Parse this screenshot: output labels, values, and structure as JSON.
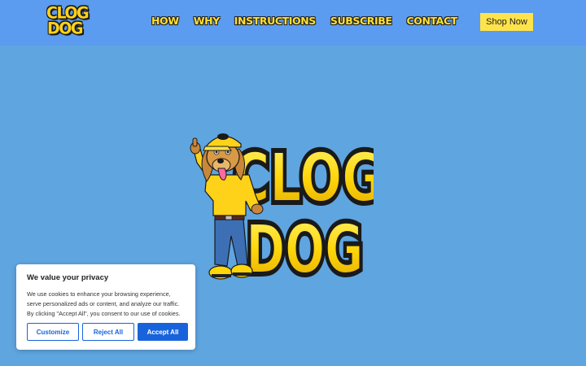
{
  "logo": {
    "line1": "CLOG",
    "line2": "DOG"
  },
  "nav": {
    "items": [
      "HOW",
      "WHY",
      "INSTRUCTIONS",
      "SUBSCRIBE",
      "CONTACT"
    ]
  },
  "header": {
    "shop_label": "Shop Now"
  },
  "hero": {
    "line1": "CLOG",
    "line2": "DOG",
    "mascot_icon": "dog-mascot-icon"
  },
  "cookie": {
    "title": "We value your privacy",
    "text": "We use cookies to enhance your browsing experience, serve personalized ads or content, and analyze our traffic. By clicking \"Accept All\", you consent to our use of cookies.",
    "customize_label": "Customize",
    "reject_label": "Reject All",
    "accept_label": "Accept All"
  },
  "colors": {
    "header_bg": "#5b9bf0",
    "page_bg": "#5fa5e0",
    "brand_yellow": "#ffe34a",
    "accent_blue": "#1863dc"
  }
}
